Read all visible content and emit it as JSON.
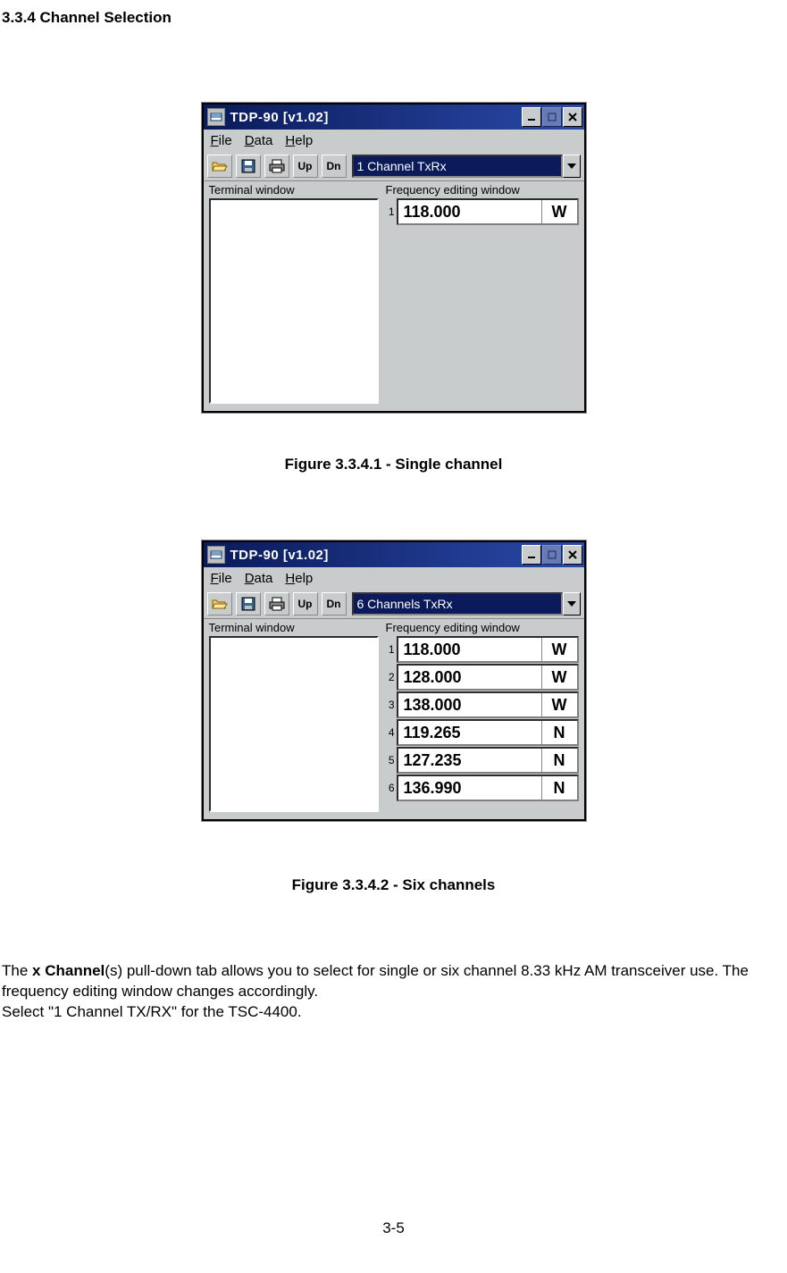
{
  "section_heading": "3.3.4    Channel Selection",
  "figure1": {
    "window": {
      "title": "TDP-90 [v1.02]",
      "menus": {
        "file": "File",
        "data": "Data",
        "help": "Help"
      },
      "toolbar": {
        "up": "Up",
        "dn": "Dn"
      },
      "combo": "1 Channel TxRx",
      "terminal_label": "Terminal window",
      "freq_label": "Frequency editing window",
      "rows": [
        {
          "idx": "1",
          "freq": "118.000",
          "wn": "W"
        }
      ]
    },
    "caption": "Figure 3.3.4.1  - Single channel"
  },
  "figure2": {
    "window": {
      "title": "TDP-90 [v1.02]",
      "menus": {
        "file": "File",
        "data": "Data",
        "help": "Help"
      },
      "toolbar": {
        "up": "Up",
        "dn": "Dn"
      },
      "combo": "6 Channels TxRx",
      "terminal_label": "Terminal window",
      "freq_label": "Frequency editing window",
      "rows": [
        {
          "idx": "1",
          "freq": "118.000",
          "wn": "W"
        },
        {
          "idx": "2",
          "freq": "128.000",
          "wn": "W"
        },
        {
          "idx": "3",
          "freq": "138.000",
          "wn": "W"
        },
        {
          "idx": "4",
          "freq": "119.265",
          "wn": "N"
        },
        {
          "idx": "5",
          "freq": "127.235",
          "wn": "N"
        },
        {
          "idx": "6",
          "freq": "136.990",
          "wn": "N"
        }
      ]
    },
    "caption": "Figure 3.3.4.2  - Six channels"
  },
  "body": {
    "p1a": "The ",
    "p1b": "x Channel",
    "p1c": "(s) pull-down tab allows you to select for single or six channel 8.33 kHz AM transceiver use. The frequency editing window changes accordingly.",
    "p2": "Select \"1 Channel TX/RX\" for the TSC-4400."
  },
  "page_number": "3-5"
}
